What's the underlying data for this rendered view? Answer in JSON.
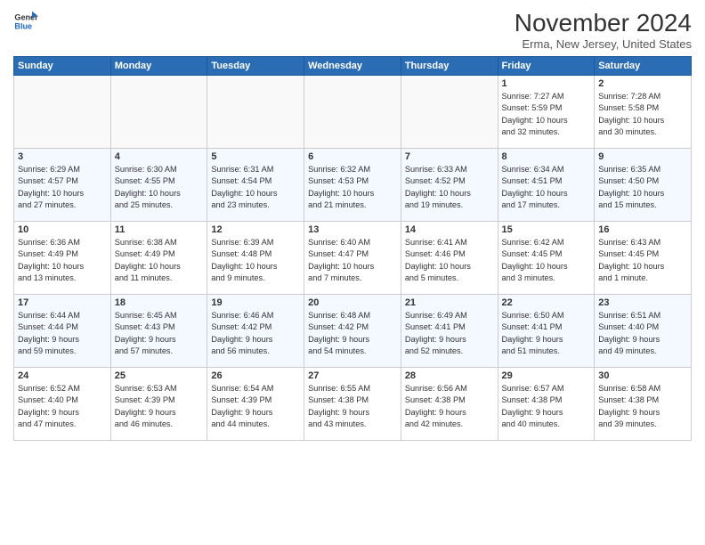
{
  "logo": {
    "general": "General",
    "blue": "Blue"
  },
  "title": "November 2024",
  "location": "Erma, New Jersey, United States",
  "days_header": [
    "Sunday",
    "Monday",
    "Tuesday",
    "Wednesday",
    "Thursday",
    "Friday",
    "Saturday"
  ],
  "weeks": [
    [
      {
        "day": "",
        "info": ""
      },
      {
        "day": "",
        "info": ""
      },
      {
        "day": "",
        "info": ""
      },
      {
        "day": "",
        "info": ""
      },
      {
        "day": "",
        "info": ""
      },
      {
        "day": "1",
        "info": "Sunrise: 7:27 AM\nSunset: 5:59 PM\nDaylight: 10 hours\nand 32 minutes."
      },
      {
        "day": "2",
        "info": "Sunrise: 7:28 AM\nSunset: 5:58 PM\nDaylight: 10 hours\nand 30 minutes."
      }
    ],
    [
      {
        "day": "3",
        "info": "Sunrise: 6:29 AM\nSunset: 4:57 PM\nDaylight: 10 hours\nand 27 minutes."
      },
      {
        "day": "4",
        "info": "Sunrise: 6:30 AM\nSunset: 4:55 PM\nDaylight: 10 hours\nand 25 minutes."
      },
      {
        "day": "5",
        "info": "Sunrise: 6:31 AM\nSunset: 4:54 PM\nDaylight: 10 hours\nand 23 minutes."
      },
      {
        "day": "6",
        "info": "Sunrise: 6:32 AM\nSunset: 4:53 PM\nDaylight: 10 hours\nand 21 minutes."
      },
      {
        "day": "7",
        "info": "Sunrise: 6:33 AM\nSunset: 4:52 PM\nDaylight: 10 hours\nand 19 minutes."
      },
      {
        "day": "8",
        "info": "Sunrise: 6:34 AM\nSunset: 4:51 PM\nDaylight: 10 hours\nand 17 minutes."
      },
      {
        "day": "9",
        "info": "Sunrise: 6:35 AM\nSunset: 4:50 PM\nDaylight: 10 hours\nand 15 minutes."
      }
    ],
    [
      {
        "day": "10",
        "info": "Sunrise: 6:36 AM\nSunset: 4:49 PM\nDaylight: 10 hours\nand 13 minutes."
      },
      {
        "day": "11",
        "info": "Sunrise: 6:38 AM\nSunset: 4:49 PM\nDaylight: 10 hours\nand 11 minutes."
      },
      {
        "day": "12",
        "info": "Sunrise: 6:39 AM\nSunset: 4:48 PM\nDaylight: 10 hours\nand 9 minutes."
      },
      {
        "day": "13",
        "info": "Sunrise: 6:40 AM\nSunset: 4:47 PM\nDaylight: 10 hours\nand 7 minutes."
      },
      {
        "day": "14",
        "info": "Sunrise: 6:41 AM\nSunset: 4:46 PM\nDaylight: 10 hours\nand 5 minutes."
      },
      {
        "day": "15",
        "info": "Sunrise: 6:42 AM\nSunset: 4:45 PM\nDaylight: 10 hours\nand 3 minutes."
      },
      {
        "day": "16",
        "info": "Sunrise: 6:43 AM\nSunset: 4:45 PM\nDaylight: 10 hours\nand 1 minute."
      }
    ],
    [
      {
        "day": "17",
        "info": "Sunrise: 6:44 AM\nSunset: 4:44 PM\nDaylight: 9 hours\nand 59 minutes."
      },
      {
        "day": "18",
        "info": "Sunrise: 6:45 AM\nSunset: 4:43 PM\nDaylight: 9 hours\nand 57 minutes."
      },
      {
        "day": "19",
        "info": "Sunrise: 6:46 AM\nSunset: 4:42 PM\nDaylight: 9 hours\nand 56 minutes."
      },
      {
        "day": "20",
        "info": "Sunrise: 6:48 AM\nSunset: 4:42 PM\nDaylight: 9 hours\nand 54 minutes."
      },
      {
        "day": "21",
        "info": "Sunrise: 6:49 AM\nSunset: 4:41 PM\nDaylight: 9 hours\nand 52 minutes."
      },
      {
        "day": "22",
        "info": "Sunrise: 6:50 AM\nSunset: 4:41 PM\nDaylight: 9 hours\nand 51 minutes."
      },
      {
        "day": "23",
        "info": "Sunrise: 6:51 AM\nSunset: 4:40 PM\nDaylight: 9 hours\nand 49 minutes."
      }
    ],
    [
      {
        "day": "24",
        "info": "Sunrise: 6:52 AM\nSunset: 4:40 PM\nDaylight: 9 hours\nand 47 minutes."
      },
      {
        "day": "25",
        "info": "Sunrise: 6:53 AM\nSunset: 4:39 PM\nDaylight: 9 hours\nand 46 minutes."
      },
      {
        "day": "26",
        "info": "Sunrise: 6:54 AM\nSunset: 4:39 PM\nDaylight: 9 hours\nand 44 minutes."
      },
      {
        "day": "27",
        "info": "Sunrise: 6:55 AM\nSunset: 4:38 PM\nDaylight: 9 hours\nand 43 minutes."
      },
      {
        "day": "28",
        "info": "Sunrise: 6:56 AM\nSunset: 4:38 PM\nDaylight: 9 hours\nand 42 minutes."
      },
      {
        "day": "29",
        "info": "Sunrise: 6:57 AM\nSunset: 4:38 PM\nDaylight: 9 hours\nand 40 minutes."
      },
      {
        "day": "30",
        "info": "Sunrise: 6:58 AM\nSunset: 4:38 PM\nDaylight: 9 hours\nand 39 minutes."
      }
    ]
  ]
}
